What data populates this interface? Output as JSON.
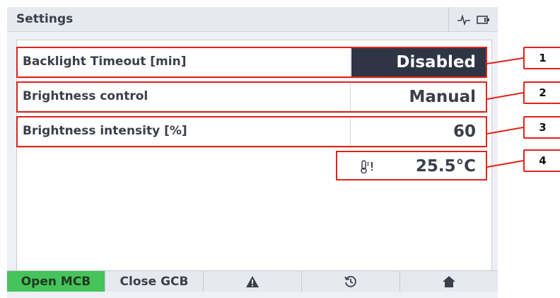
{
  "header": {
    "title": "Settings",
    "icons": [
      "pulse-icon",
      "battery-icon"
    ]
  },
  "settings": [
    {
      "label": "Backlight Timeout [min]",
      "value": "Disabled",
      "selected": true
    },
    {
      "label": "Brightness control",
      "value": "Manual",
      "selected": false
    },
    {
      "label": "Brightness intensity [%]",
      "value": "60",
      "selected": false
    }
  ],
  "temperature": {
    "icon": "thermometer-warning-icon",
    "value": "25.5°C"
  },
  "callouts": [
    "1",
    "2",
    "3",
    "4"
  ],
  "footer": {
    "buttons": [
      {
        "label": "Open MCB",
        "color": "#46c35a"
      },
      {
        "label": "Close GCB"
      },
      {
        "icon": "warning-icon"
      },
      {
        "icon": "history-icon"
      },
      {
        "icon": "home-icon"
      }
    ]
  },
  "colors": {
    "annotation": "#e2231a",
    "selected_value_bg": "#2f3545",
    "accent_green": "#46c35a"
  }
}
